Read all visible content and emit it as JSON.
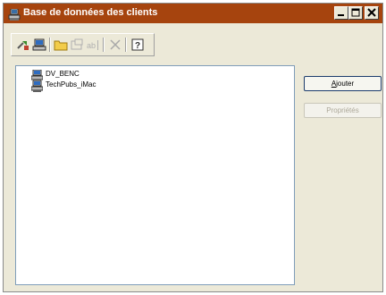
{
  "window": {
    "title": "Base de données des clients",
    "title_bar_color": "#a6440e",
    "controls": [
      "minimize-icon",
      "maximize-icon",
      "close-icon"
    ]
  },
  "toolbar": {
    "buttons": [
      "connect-icon",
      "refresh-icon",
      "folder-icon",
      "properties-icon",
      "rename-icon",
      "delete-icon",
      "help-icon"
    ]
  },
  "list": {
    "items": [
      {
        "label": "DV_BENC",
        "icon": "client-computer-icon"
      },
      {
        "label": "TechPubs_iMac",
        "icon": "client-computer-icon"
      }
    ]
  },
  "buttons": {
    "add": {
      "label_prefix": "",
      "mnemonic": "A",
      "label_rest": "jouter",
      "enabled": true
    },
    "properties": {
      "label": "Propriétés",
      "enabled": false
    }
  }
}
